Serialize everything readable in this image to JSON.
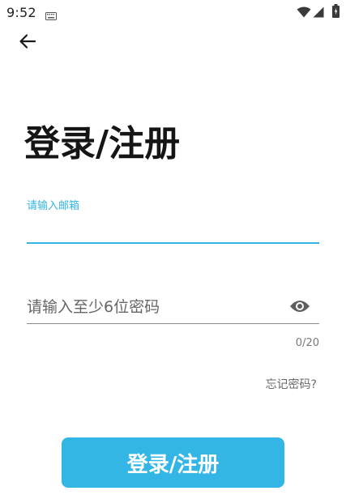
{
  "status_bar": {
    "time": "9:52",
    "icons": [
      "keyboard-icon",
      "wifi-icon",
      "signal-icon",
      "battery-icon"
    ]
  },
  "nav": {
    "back_icon": "arrow-left-icon"
  },
  "page": {
    "title": "登录/注册"
  },
  "email": {
    "label": "请输入邮箱",
    "value": ""
  },
  "password": {
    "placeholder": "请输入至少6位密码",
    "value": "",
    "toggle_icon": "eye-icon",
    "counter": "0/20"
  },
  "forgot_password": {
    "label": "忘记密码?"
  },
  "submit": {
    "label": "登录/注册"
  },
  "colors": {
    "accent": "#33b6e6",
    "title": "#151515",
    "muted": "#6a6a6a",
    "background": "#ffffff"
  }
}
